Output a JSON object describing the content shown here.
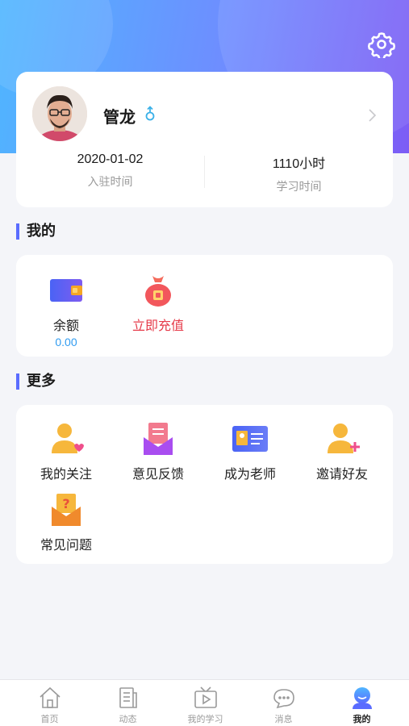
{
  "profile": {
    "name": "管龙",
    "join_date": "2020-01-02",
    "join_label": "入驻时间",
    "study_time": "1110小时",
    "study_label": "学习时间"
  },
  "mine": {
    "title": "我的",
    "items": [
      {
        "label": "余额",
        "value": "0.00",
        "icon": "wallet-icon"
      },
      {
        "label": "立即充值",
        "icon": "money-bag-icon"
      }
    ]
  },
  "more": {
    "title": "更多",
    "items": [
      {
        "label": "我的关注",
        "icon": "user-heart-icon"
      },
      {
        "label": "意见反馈",
        "icon": "feedback-envelope-icon"
      },
      {
        "label": "成为老师",
        "icon": "id-card-icon"
      },
      {
        "label": "邀请好友",
        "icon": "user-add-icon"
      },
      {
        "label": "常见问题",
        "icon": "question-envelope-icon"
      }
    ]
  },
  "tabbar": {
    "items": [
      {
        "label": "首页",
        "icon": "home-icon"
      },
      {
        "label": "动态",
        "icon": "document-icon"
      },
      {
        "label": "我的学习",
        "icon": "tv-play-icon"
      },
      {
        "label": "消息",
        "icon": "chat-icon"
      },
      {
        "label": "我的",
        "icon": "user-icon",
        "active": true
      }
    ]
  },
  "colors": {
    "accent": "#5a6cff",
    "recharge_red": "#e63b4a",
    "balance_blue": "#2f9bf0",
    "gender_blue": "#3bb1e8"
  }
}
